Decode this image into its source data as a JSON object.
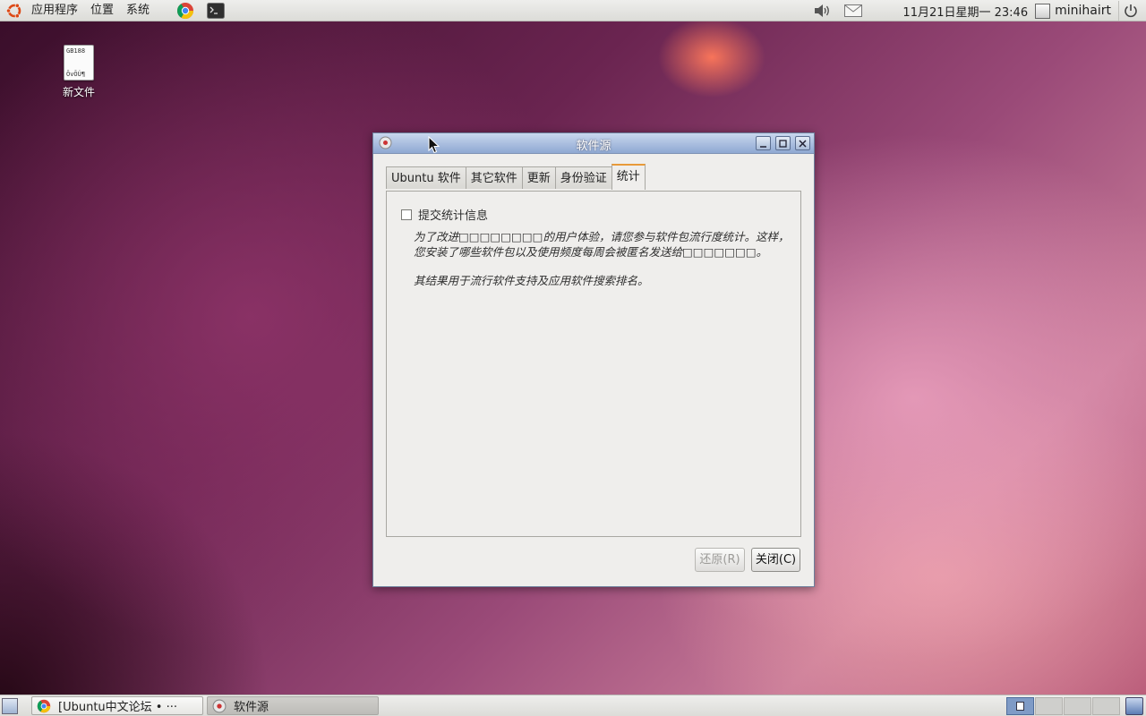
{
  "top_panel": {
    "menus": [
      "应用程序",
      "位置",
      "系统"
    ],
    "launchers": [
      "chrome-icon",
      "terminal-icon"
    ],
    "tray": [
      "volume-icon",
      "mail-icon"
    ],
    "clock": "11月21日星期一 23:46",
    "user": "minihairt",
    "power_icon": "power-icon"
  },
  "desktop": {
    "file_icon_top": "GB188",
    "file_icon_bottom": "ÕvÕÚ¶",
    "file_label": "新文件"
  },
  "window": {
    "title": "软件源",
    "tabs": [
      "Ubuntu 软件",
      "其它软件",
      "更新",
      "身份验证",
      "统计"
    ],
    "active_tab": "统计",
    "checkbox_label": "提交统计信息",
    "checkbox_checked": false,
    "desc_1": "为了改进□□□□□□□□的用户体验，请您参与软件包流行度统计。这样，您安装了哪些软件包以及使用频度每周会被匿名发送给□□□□□□□。",
    "desc_2": "其结果用于流行软件支持及应用软件搜索排名。",
    "revert_label": "还原(R)",
    "close_label": "关闭(C)"
  },
  "taskbar": {
    "tasks": [
      "[Ubuntu中文论坛 • ···",
      "软件源"
    ],
    "workspaces": 4,
    "active_workspace": 1
  },
  "colors": {
    "titlebar": "#8ea8d2",
    "active_tab_accent": "#e89a3a",
    "panel": "#dcdcd8"
  }
}
